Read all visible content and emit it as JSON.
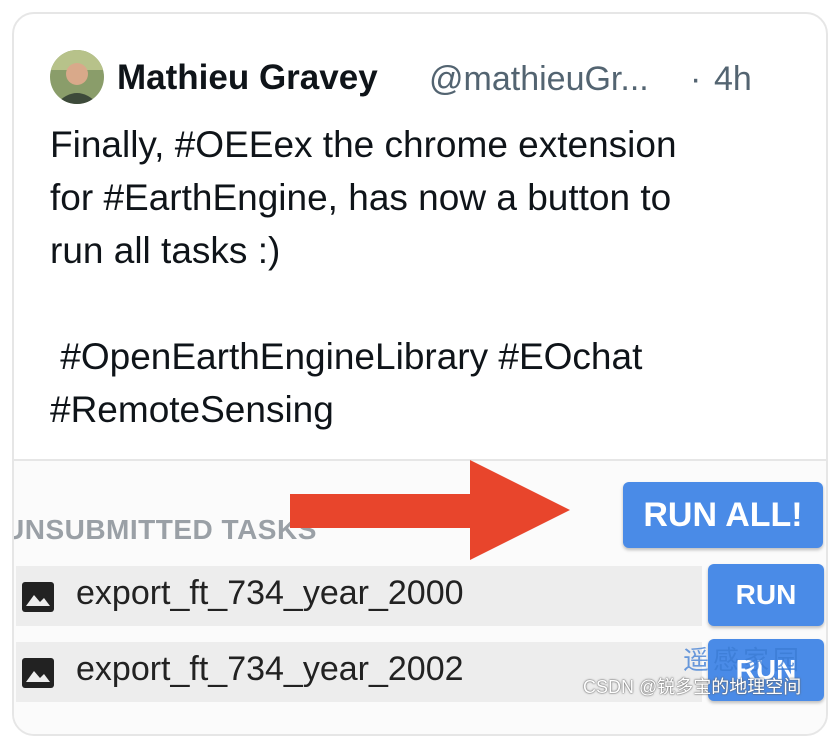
{
  "tweet": {
    "author_name": "Mathieu Gravey",
    "handle": "@mathieuGr...",
    "separator": "·",
    "time": "4h",
    "lines": [
      "Finally, #OEEex the chrome extension",
      "for #EarthEngine, has now a button to",
      "run all tasks :)",
      " #OpenEarthEngineLibrary #EOchat",
      "#RemoteSensing"
    ]
  },
  "embed": {
    "section_title": "UNSUBMITTED TASKS",
    "run_all_label": "RUN ALL!",
    "tasks": [
      {
        "name": "export_ft_734_year_2000",
        "button": "RUN"
      },
      {
        "name": "export_ft_734_year_2002",
        "button": "RUN"
      }
    ],
    "arrow_color": "#e8452c"
  },
  "watermark": {
    "stamp_text": "遥感家园",
    "csdn_text": "CSDN @锐多宝的地理空间"
  },
  "colors": {
    "button_blue": "#4a8be7",
    "text_primary": "#0f1419",
    "text_secondary": "#536471"
  }
}
